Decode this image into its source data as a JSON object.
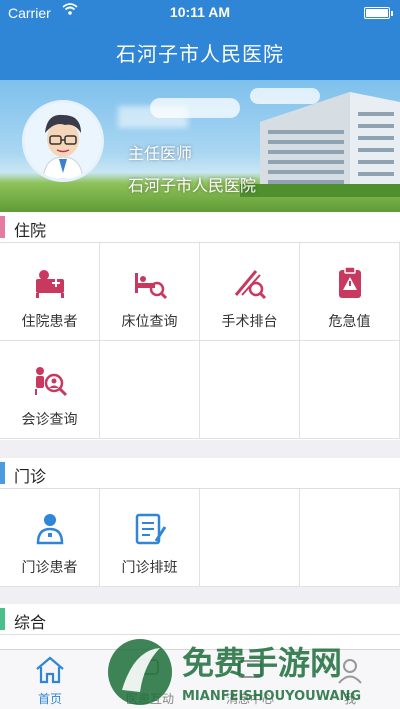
{
  "status": {
    "carrier": "Carrier",
    "time": "10:11 AM"
  },
  "nav": {
    "title": "石河子市人民医院"
  },
  "profile": {
    "title": "主任医师",
    "hospital": "石河子市人民医院"
  },
  "sections": {
    "inpatient": {
      "label": "住院",
      "color": "#e57b9e",
      "items": [
        {
          "label": "住院患者",
          "icon": "inpatient-icon"
        },
        {
          "label": "床位查询",
          "icon": "bed-search-icon"
        },
        {
          "label": "手术排台",
          "icon": "surgery-icon"
        },
        {
          "label": "危急值",
          "icon": "critical-value-icon"
        },
        {
          "label": "会诊查询",
          "icon": "consultation-icon"
        }
      ]
    },
    "outpatient": {
      "label": "门诊",
      "color": "#4a9be0",
      "items": [
        {
          "label": "门诊患者",
          "icon": "outpatient-icon"
        },
        {
          "label": "门诊排班",
          "icon": "schedule-icon"
        }
      ]
    },
    "general": {
      "label": "综合",
      "color": "#4bbf8a"
    }
  },
  "tabs": [
    {
      "label": "首页",
      "icon": "home-icon"
    },
    {
      "label": "医患互动",
      "icon": "interaction-icon"
    },
    {
      "label": "消息中心",
      "icon": "message-icon"
    },
    {
      "label": "我",
      "icon": "profile-icon"
    }
  ],
  "watermark": {
    "main": "免费手游网",
    "sub": "MIANFEISHOUYOUWANG"
  },
  "colors": {
    "primary": "#2f85d6",
    "icon_red": "#c9385f",
    "icon_blue": "#2f85d6"
  }
}
